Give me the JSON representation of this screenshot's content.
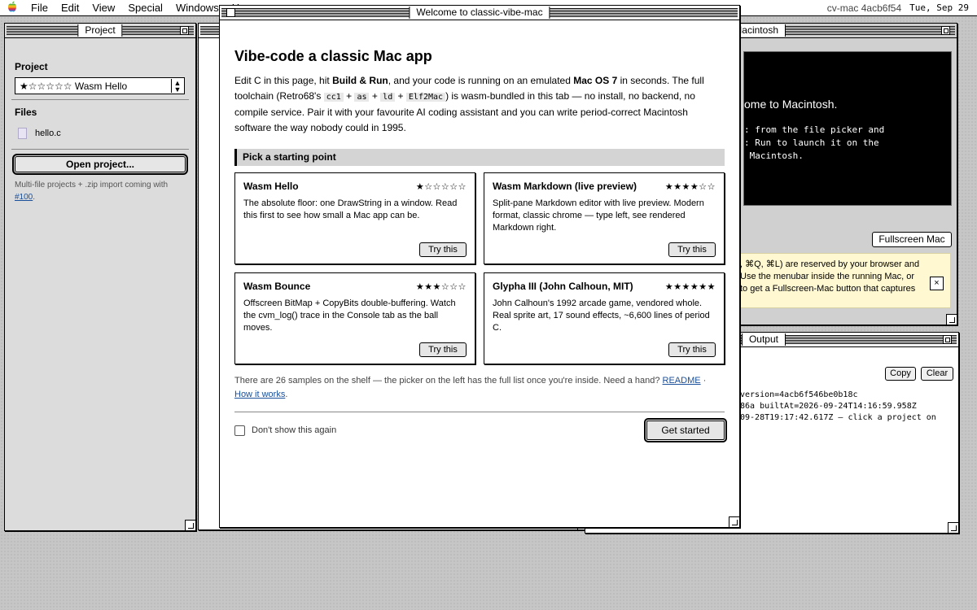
{
  "menubar": {
    "apple_icon": "apple-icon",
    "items": [
      "File",
      "Edit",
      "View",
      "Special",
      "Windows",
      "H"
    ],
    "build": "cv-mac 4acb6f54",
    "date": "Tue, Sep 29"
  },
  "project_window": {
    "title": "Project",
    "project_label": "Project",
    "project_value": "★☆☆☆☆☆ Wasm Hello",
    "files_label": "Files",
    "files": [
      "hello.c"
    ],
    "open_button": "Open project...",
    "note_text": "Multi-file projects + .zip import coming with",
    "note_link": "#100",
    "note_end": "."
  },
  "mac_window": {
    "title": "Macintosh",
    "screen_welcome": "ome to Macintosh.",
    "screen_lines": ": from the file picker and\n: Run to launch it on the\n Macintosh.",
    "fullscreen_button": "Fullscreen Mac",
    "notice_text": ", ⌘Q, ⌘L) are reserved by your browser and\nUse the menubar inside the running Mac, or\nto get a Fullscreen-Mac button that captures",
    "notice_close": "×"
  },
  "output_window": {
    "title": "Output",
    "copy_button": "Copy",
    "clear_button": "Clear",
    "lines": "version=4acb6f546be0b18c\n86a builtAt=2026-09-24T14:16:59.958Z\n09-28T19:17:42.617Z — click a project on"
  },
  "dialog": {
    "title": "Welcome to classic-vibe-mac",
    "heading": "Vibe-code a classic Mac app",
    "intro_1": "Edit C in this page, hit ",
    "intro_build_run": "Build & Run",
    "intro_2": ", and your code is running on an emulated ",
    "intro_os": "Mac OS 7",
    "intro_3": " in seconds. The full toolchain (Retro68's ",
    "code_cc1": "cc1",
    "plus": " + ",
    "code_as": "as",
    "code_ld": "ld",
    "code_elf": "Elf2Mac",
    "intro_4": ") is wasm-bundled in this tab — no install, no backend, no compile service. Pair it with your favourite AI coding assistant and you can write period-correct Macintosh software the way nobody could in 1995.",
    "pick_heading": "Pick a starting point",
    "cards": [
      {
        "title": "Wasm Hello",
        "stars": "★☆☆☆☆☆",
        "desc": "The absolute floor: one DrawString in a window. Read this first to see how small a Mac app can be.",
        "button": "Try this"
      },
      {
        "title": "Wasm Markdown (live preview)",
        "stars": "★★★★☆☆",
        "desc": "Split-pane Markdown editor with live preview. Modern format, classic chrome — type left, see rendered Markdown right.",
        "button": "Try this"
      },
      {
        "title": "Wasm Bounce",
        "stars": "★★★☆☆☆",
        "desc": "Offscreen BitMap + CopyBits double-buffering. Watch the cvm_log() trace in the Console tab as the ball moves.",
        "button": "Try this"
      },
      {
        "title": "Glypha III (John Calhoun, MIT)",
        "stars": "★★★★★★",
        "desc": "John Calhoun's 1992 arcade game, vendored whole. Real sprite art, 17 sound effects, ~6,600 lines of period C.",
        "button": "Try this"
      }
    ],
    "footer_text": "There are 26 samples on the shelf — the picker on the left has the full list once you're inside. Need a hand? ",
    "footer_link_1": "README",
    "footer_sep": " · ",
    "footer_link_2": "How it works",
    "footer_end": ".",
    "checkbox_label": "Don't show this again",
    "get_started": "Get started"
  }
}
